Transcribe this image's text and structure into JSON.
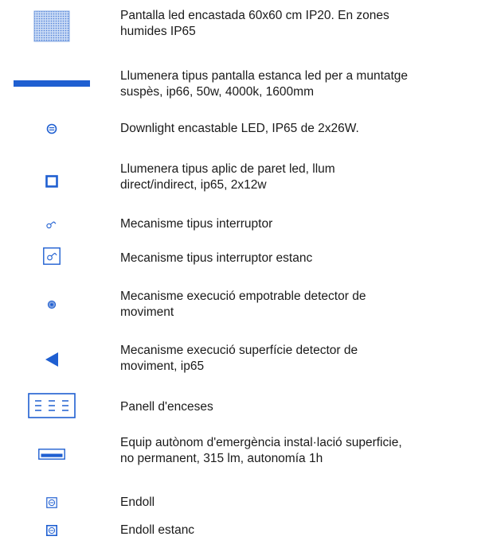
{
  "legend": {
    "items": [
      {
        "symbol": "led-panel-icon",
        "line1": "Pantalla led encastada 60x60 cm IP20. En zones",
        "line2": "humides IP65"
      },
      {
        "symbol": "linear-luminaire-icon",
        "line1": "Llumenera tipus pantalla estanca led per a muntatge",
        "line2": "suspès, ip66, 50w, 4000k, 1600mm"
      },
      {
        "symbol": "downlight-icon",
        "line1": "Downlight encastable LED, IP65 de 2x26W.",
        "line2": ""
      },
      {
        "symbol": "wall-light-icon",
        "line1": "Llumenera tipus aplic de paret led, llum",
        "line2": "direct/indirect, ip65, 2x12w"
      },
      {
        "symbol": "switch-icon",
        "line1": "Mecanisme tipus interruptor",
        "line2": ""
      },
      {
        "symbol": "waterproof-switch-icon",
        "line1": "Mecanisme tipus interruptor estanc",
        "line2": ""
      },
      {
        "symbol": "flush-motion-detector-icon",
        "line1": "Mecanisme execució empotrable detector de",
        "line2": "moviment"
      },
      {
        "symbol": "surface-motion-detector-icon",
        "line1": "Mecanisme execució superfície detector de",
        "line2": "moviment, ip65"
      },
      {
        "symbol": "switch-panel-icon",
        "line1": "Panell d'enceses",
        "line2": ""
      },
      {
        "symbol": "emergency-light-icon",
        "line1": "Equip autònom d'emergència instal·lació superficie,",
        "line2": "no permanent, 315 lm, autonomía 1h"
      },
      {
        "symbol": "socket-icon",
        "line1": "Endoll",
        "line2": ""
      },
      {
        "symbol": "waterproof-socket-icon",
        "line1": "Endoll estanc",
        "line2": ""
      }
    ]
  },
  "colors": {
    "symbol_blue": "#1f5fd1",
    "panel_fill": "#8fb3e8",
    "text": "#1a1a1a"
  }
}
